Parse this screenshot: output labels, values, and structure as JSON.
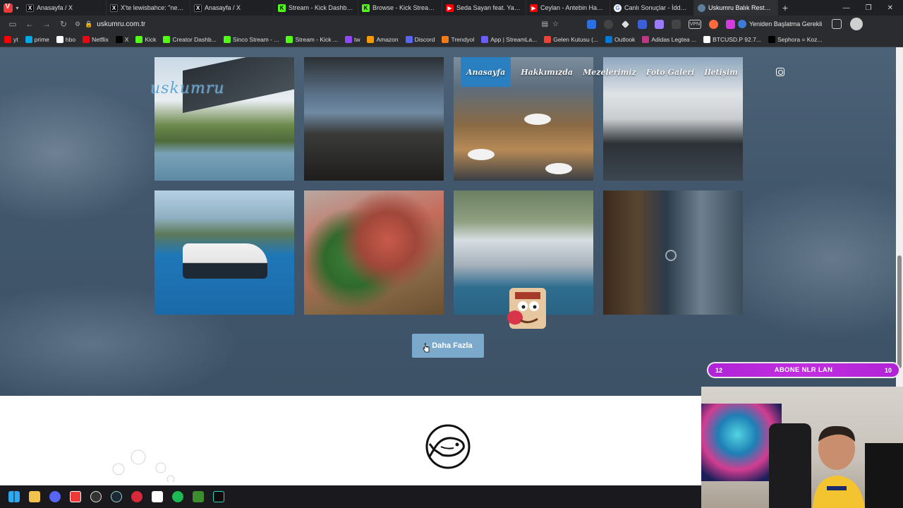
{
  "browser": {
    "tabs": [
      {
        "label": "Anasayfa / X",
        "icon": "x",
        "active": false
      },
      {
        "label": "X'te lewisbahce: \"ney ney n",
        "icon": "x",
        "active": false
      },
      {
        "label": "Anasayfa / X",
        "icon": "x",
        "active": false
      },
      {
        "label": "Stream - Kick Dashboard",
        "icon": "k",
        "active": false
      },
      {
        "label": "Browse - Kick Streaming",
        "icon": "k",
        "active": false
      },
      {
        "label": "Seda Sayan feat. Yasin Kele",
        "icon": "yt",
        "active": false
      },
      {
        "label": "Ceylan - Antebin Hamamla",
        "icon": "yt",
        "active": false
      },
      {
        "label": "Canlı Sonuçlar - İddaa Sonu",
        "icon": "g",
        "active": false
      },
      {
        "label": "Uskumru Balık Restaurant -",
        "icon": "bk",
        "active": true
      }
    ],
    "url": "uskumru.com.tr",
    "restart_label": "Yeniden Başlatma Gerekli",
    "vpn_label": "VPN",
    "bookmarks": [
      {
        "label": "yt",
        "color": "#ff0000"
      },
      {
        "label": "prime",
        "color": "#00a8e1"
      },
      {
        "label": "hbo",
        "color": "#ffffff"
      },
      {
        "label": "Netflix",
        "color": "#e50914"
      },
      {
        "label": "X",
        "color": "#000000"
      },
      {
        "label": "Kick",
        "color": "#53fc18"
      },
      {
        "label": "Creator Dashb...",
        "color": "#53fc18"
      },
      {
        "label": "Sinco Stream - ...",
        "color": "#53fc18"
      },
      {
        "label": "Stream - Kick ...",
        "color": "#53fc18"
      },
      {
        "label": "tw",
        "color": "#9146ff"
      },
      {
        "label": "Amazon",
        "color": "#ff9900"
      },
      {
        "label": "Discord",
        "color": "#5865f2"
      },
      {
        "label": "Trendyol",
        "color": "#f27a1a"
      },
      {
        "label": "App | StreamLa...",
        "color": "#6b5cff"
      },
      {
        "label": "Gelen Kutusu (...",
        "color": "#ea4335"
      },
      {
        "label": "Outlook",
        "color": "#0078d4"
      },
      {
        "label": "Adidas Legtea ...",
        "color": "#c13584"
      },
      {
        "label": "BTCUSD.P 92.7...",
        "color": "#ffffff"
      },
      {
        "label": "Sephora = Koz...",
        "color": "#000000"
      }
    ]
  },
  "site": {
    "logo_text": "uskumru",
    "nav": [
      {
        "label": "Anasayfa",
        "active": true
      },
      {
        "label": "Hakkımızda",
        "active": false
      },
      {
        "label": "Mezelerimiz",
        "active": false
      },
      {
        "label": "Foto Galeri",
        "active": false
      },
      {
        "label": "İletişim",
        "active": false
      }
    ],
    "more_button_label": "Daha Fazla",
    "accent_color": "#2a7fc0"
  },
  "overlay": {
    "sub_goal_left": "12",
    "sub_goal_label": "ABONE NLR LAN",
    "sub_goal_right": "10",
    "bar_color": "#c12ee0"
  }
}
